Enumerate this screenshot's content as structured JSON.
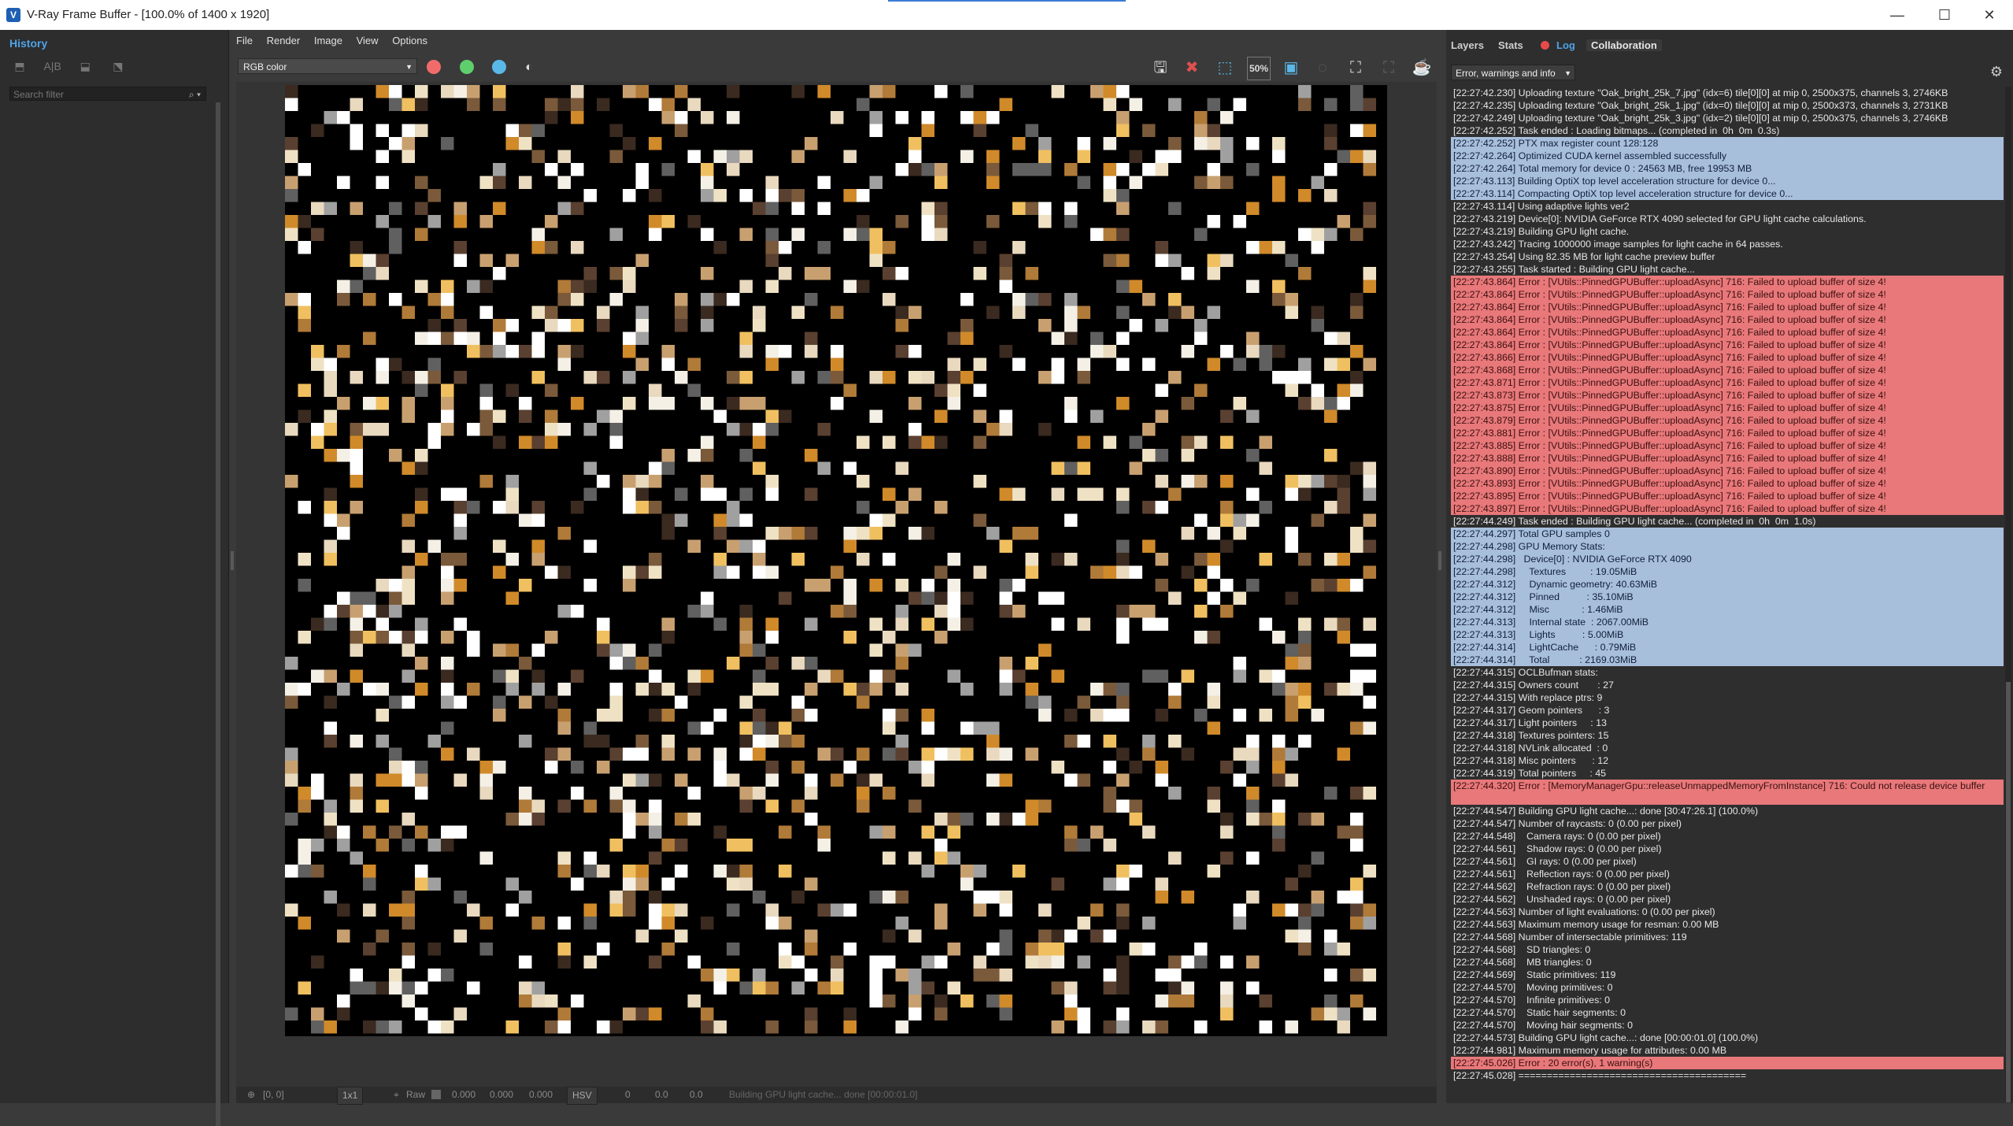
{
  "window": {
    "title": "V-Ray Frame Buffer - [100.0% of 1400 x 1920]",
    "controls": [
      "—",
      "☐",
      "✕"
    ]
  },
  "history": {
    "tab": "History",
    "filter_placeholder": "Search filter"
  },
  "menu": [
    "File",
    "Render",
    "Image",
    "View",
    "Options"
  ],
  "toolbar": {
    "channel": "RGB color",
    "zoom_badge": "50%",
    "colors": {
      "red": "#f16b6b",
      "green": "#5fcf6e",
      "blue": "#5ab8e8"
    }
  },
  "statusbar": {
    "coords": "[0, 0]",
    "zoom": "1x1",
    "raw": "Raw",
    "r": "0.000",
    "g": "0.000",
    "b": "0.000",
    "mode": "HSV",
    "h": "0",
    "s": "0.0",
    "v": "0.0",
    "message": "Building GPU light cache... done [00:00:01.0]"
  },
  "rightpanel": {
    "tabs": [
      "Layers",
      "Stats",
      "Log",
      "Collaboration"
    ],
    "log_filter": "Error, warnings and info",
    "colors": {
      "error": "#e8787a",
      "info": "#a8bfdc",
      "log_dot": "#e84a4a",
      "active_tab": "#4fa3e6"
    }
  },
  "log": [
    {
      "t": "plain",
      "s": "[22:27:42.230] Uploading texture \"Oak_bright_25k_7.jpg\" (idx=6) tile[0][0] at mip 0, 2500x375, channels 3, 2746KB"
    },
    {
      "t": "plain",
      "s": "[22:27:42.235] Uploading texture \"Oak_bright_25k_1.jpg\" (idx=0) tile[0][0] at mip 0, 2500x373, channels 3, 2731KB"
    },
    {
      "t": "plain",
      "s": "[22:27:42.249] Uploading texture \"Oak_bright_25k_3.jpg\" (idx=2) tile[0][0] at mip 0, 2500x375, channels 3, 2746KB"
    },
    {
      "t": "plain",
      "s": "[22:27:42.252] Task ended : Loading bitmaps... (completed in  0h  0m  0.3s)"
    },
    {
      "t": "info",
      "s": "[22:27:42.252] PTX max register count 128:128"
    },
    {
      "t": "info",
      "s": "[22:27:42.264] Optimized CUDA kernel assembled successfully"
    },
    {
      "t": "info",
      "s": "[22:27:42.264] Total memory for device 0 : 24563 MB, free 19953 MB"
    },
    {
      "t": "info",
      "s": "[22:27:43.113] Building OptiX top level acceleration structure for device 0..."
    },
    {
      "t": "info",
      "s": "[22:27:43.114] Compacting OptiX top level acceleration structure for device 0..."
    },
    {
      "t": "plain",
      "s": "[22:27:43.114] Using adaptive lights ver2"
    },
    {
      "t": "plain",
      "s": "[22:27:43.219] Device[0]: NVIDIA GeForce RTX 4090 selected for GPU light cache calculations."
    },
    {
      "t": "plain",
      "s": "[22:27:43.219] Building GPU light cache."
    },
    {
      "t": "plain",
      "s": "[22:27:43.242] Tracing 1000000 image samples for light cache in 64 passes."
    },
    {
      "t": "plain",
      "s": "[22:27:43.254] Using 82.35 MB for light cache preview buffer"
    },
    {
      "t": "plain",
      "s": "[22:27:43.255] Task started : Building GPU light cache..."
    },
    {
      "t": "error",
      "s": "[22:27:43.864] Error : [VUtils::PinnedGPUBuffer::uploadAsync] 716: Failed to upload buffer of size 4!"
    },
    {
      "t": "error",
      "s": "[22:27:43.864] Error : [VUtils::PinnedGPUBuffer::uploadAsync] 716: Failed to upload buffer of size 4!"
    },
    {
      "t": "error",
      "s": "[22:27:43.864] Error : [VUtils::PinnedGPUBuffer::uploadAsync] 716: Failed to upload buffer of size 4!"
    },
    {
      "t": "error",
      "s": "[22:27:43.864] Error : [VUtils::PinnedGPUBuffer::uploadAsync] 716: Failed to upload buffer of size 4!"
    },
    {
      "t": "error",
      "s": "[22:27:43.864] Error : [VUtils::PinnedGPUBuffer::uploadAsync] 716: Failed to upload buffer of size 4!"
    },
    {
      "t": "error",
      "s": "[22:27:43.864] Error : [VUtils::PinnedGPUBuffer::uploadAsync] 716: Failed to upload buffer of size 4!"
    },
    {
      "t": "error",
      "s": "[22:27:43.866] Error : [VUtils::PinnedGPUBuffer::uploadAsync] 716: Failed to upload buffer of size 4!"
    },
    {
      "t": "error",
      "s": "[22:27:43.868] Error : [VUtils::PinnedGPUBuffer::uploadAsync] 716: Failed to upload buffer of size 4!"
    },
    {
      "t": "error",
      "s": "[22:27:43.871] Error : [VUtils::PinnedGPUBuffer::uploadAsync] 716: Failed to upload buffer of size 4!"
    },
    {
      "t": "error",
      "s": "[22:27:43.873] Error : [VUtils::PinnedGPUBuffer::uploadAsync] 716: Failed to upload buffer of size 4!"
    },
    {
      "t": "error",
      "s": "[22:27:43.875] Error : [VUtils::PinnedGPUBuffer::uploadAsync] 716: Failed to upload buffer of size 4!"
    },
    {
      "t": "error",
      "s": "[22:27:43.879] Error : [VUtils::PinnedGPUBuffer::uploadAsync] 716: Failed to upload buffer of size 4!"
    },
    {
      "t": "error",
      "s": "[22:27:43.881] Error : [VUtils::PinnedGPUBuffer::uploadAsync] 716: Failed to upload buffer of size 4!"
    },
    {
      "t": "error",
      "s": "[22:27:43.885] Error : [VUtils::PinnedGPUBuffer::uploadAsync] 716: Failed to upload buffer of size 4!"
    },
    {
      "t": "error",
      "s": "[22:27:43.888] Error : [VUtils::PinnedGPUBuffer::uploadAsync] 716: Failed to upload buffer of size 4!"
    },
    {
      "t": "error",
      "s": "[22:27:43.890] Error : [VUtils::PinnedGPUBuffer::uploadAsync] 716: Failed to upload buffer of size 4!"
    },
    {
      "t": "error",
      "s": "[22:27:43.893] Error : [VUtils::PinnedGPUBuffer::uploadAsync] 716: Failed to upload buffer of size 4!"
    },
    {
      "t": "error",
      "s": "[22:27:43.895] Error : [VUtils::PinnedGPUBuffer::uploadAsync] 716: Failed to upload buffer of size 4!"
    },
    {
      "t": "error",
      "s": "[22:27:43.897] Error : [VUtils::PinnedGPUBuffer::uploadAsync] 716: Failed to upload buffer of size 4!"
    },
    {
      "t": "plain",
      "s": "[22:27:44.249] Task ended : Building GPU light cache... (completed in  0h  0m  1.0s)"
    },
    {
      "t": "info",
      "s": "[22:27:44.297] Total GPU samples 0"
    },
    {
      "t": "info",
      "s": "[22:27:44.298] GPU Memory Stats:"
    },
    {
      "t": "info",
      "s": "[22:27:44.298]   Device[0] : NVIDIA GeForce RTX 4090"
    },
    {
      "t": "info",
      "s": "[22:27:44.298]     Textures         : 19.05MiB"
    },
    {
      "t": "info",
      "s": "[22:27:44.312]     Dynamic geometry: 40.63MiB"
    },
    {
      "t": "info",
      "s": "[22:27:44.312]     Pinned          : 35.10MiB"
    },
    {
      "t": "info",
      "s": "[22:27:44.312]     Misc            : 1.46MiB"
    },
    {
      "t": "info",
      "s": "[22:27:44.313]     Internal state  : 2067.00MiB"
    },
    {
      "t": "info",
      "s": "[22:27:44.313]     Lights          : 5.00MiB"
    },
    {
      "t": "info",
      "s": "[22:27:44.314]     LightCache      : 0.79MiB"
    },
    {
      "t": "info",
      "s": "[22:27:44.314]     Total           : 2169.03MiB"
    },
    {
      "t": "plain",
      "s": "[22:27:44.315] OCLBufman stats:"
    },
    {
      "t": "plain",
      "s": "[22:27:44.315] Owners count       : 27"
    },
    {
      "t": "plain",
      "s": "[22:27:44.315] With replace ptrs: 9"
    },
    {
      "t": "plain",
      "s": "[22:27:44.317] Geom pointers      : 3"
    },
    {
      "t": "plain",
      "s": "[22:27:44.317] Light pointers     : 13"
    },
    {
      "t": "plain",
      "s": "[22:27:44.318] Textures pointers: 15"
    },
    {
      "t": "plain",
      "s": "[22:27:44.318] NVLink allocated  : 0"
    },
    {
      "t": "plain",
      "s": "[22:27:44.318] Misc pointers      : 12"
    },
    {
      "t": "plain",
      "s": "[22:27:44.319] Total pointers     : 45"
    },
    {
      "t": "error multi",
      "s": "[22:27:44.320] Error : [MemoryManagerGpu::releaseUnmappedMemoryFromInstance] 716: Could not release device buffer"
    },
    {
      "t": "plain",
      "s": "[22:27:44.547] Building GPU light cache...: done [30:47:26.1] (100.0%)"
    },
    {
      "t": "plain",
      "s": "[22:27:44.547] Number of raycasts: 0 (0.00 per pixel)"
    },
    {
      "t": "plain",
      "s": "[22:27:44.548]    Camera rays: 0 (0.00 per pixel)"
    },
    {
      "t": "plain",
      "s": "[22:27:44.561]    Shadow rays: 0 (0.00 per pixel)"
    },
    {
      "t": "plain",
      "s": "[22:27:44.561]    GI rays: 0 (0.00 per pixel)"
    },
    {
      "t": "plain",
      "s": "[22:27:44.561]    Reflection rays: 0 (0.00 per pixel)"
    },
    {
      "t": "plain",
      "s": "[22:27:44.562]    Refraction rays: 0 (0.00 per pixel)"
    },
    {
      "t": "plain",
      "s": "[22:27:44.562]    Unshaded rays: 0 (0.00 per pixel)"
    },
    {
      "t": "plain",
      "s": "[22:27:44.563] Number of light evaluations: 0 (0.00 per pixel)"
    },
    {
      "t": "plain",
      "s": "[22:27:44.563] Maximum memory usage for resman: 0.00 MB"
    },
    {
      "t": "plain",
      "s": "[22:27:44.568] Number of intersectable primitives: 119"
    },
    {
      "t": "plain",
      "s": "[22:27:44.568]    SD triangles: 0"
    },
    {
      "t": "plain",
      "s": "[22:27:44.568]    MB triangles: 0"
    },
    {
      "t": "plain",
      "s": "[22:27:44.569]    Static primitives: 119"
    },
    {
      "t": "plain",
      "s": "[22:27:44.570]    Moving primitives: 0"
    },
    {
      "t": "plain",
      "s": "[22:27:44.570]    Infinite primitives: 0"
    },
    {
      "t": "plain",
      "s": "[22:27:44.570]    Static hair segments: 0"
    },
    {
      "t": "plain",
      "s": "[22:27:44.570]    Moving hair segments: 0"
    },
    {
      "t": "plain",
      "s": "[22:27:44.573] Building GPU light cache...: done [00:00:01.0] (100.0%)"
    },
    {
      "t": "plain",
      "s": "[22:27:44.981] Maximum memory usage for attributes: 0.00 MB"
    },
    {
      "t": "error",
      "s": "[22:27:45.026] Error : 20 error(s), 1 warning(s)"
    },
    {
      "t": "plain",
      "s": "[22:27:45.028] ========================================"
    }
  ]
}
